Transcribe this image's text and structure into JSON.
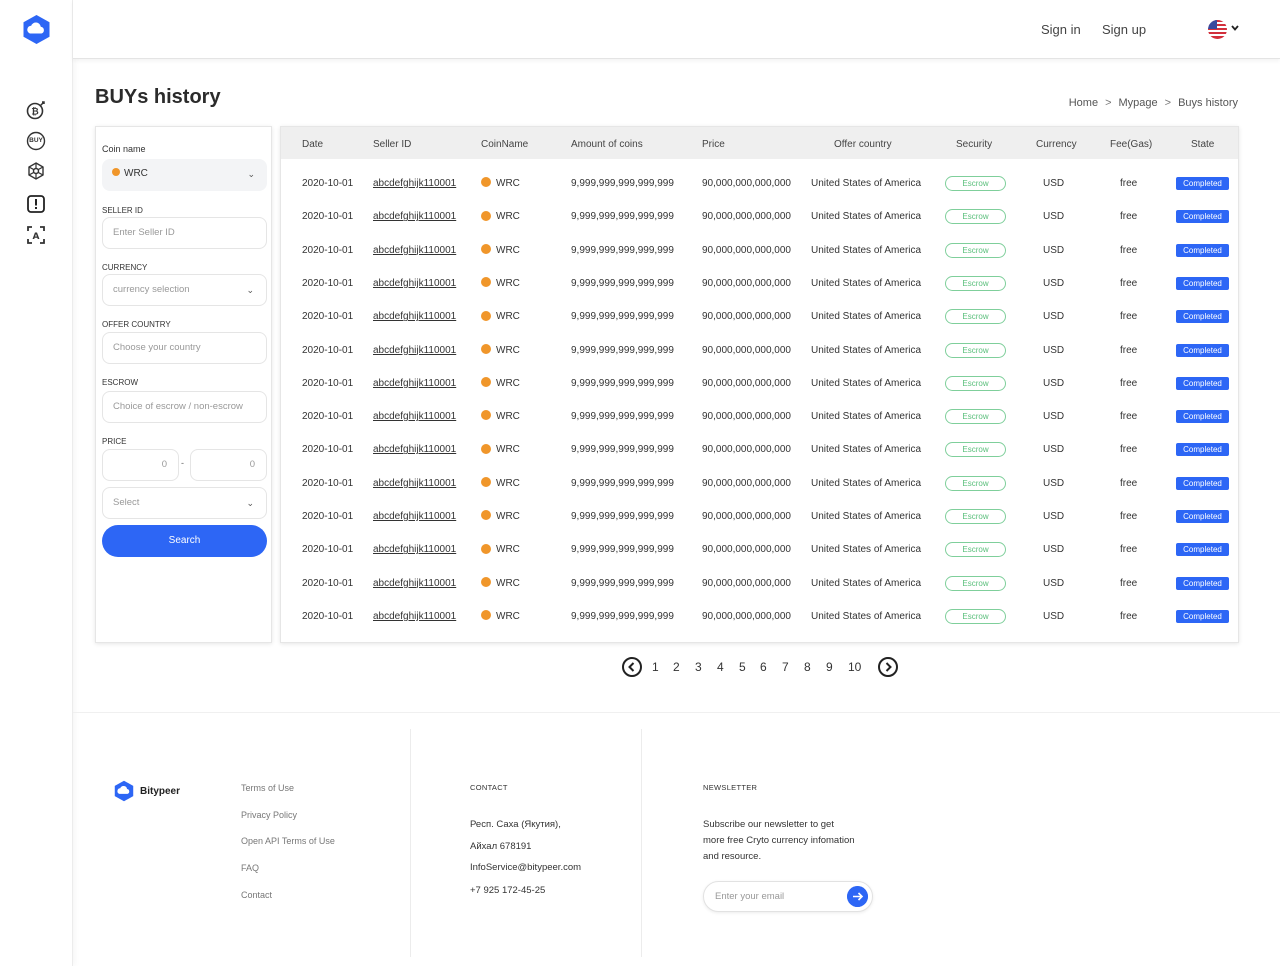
{
  "header": {
    "sign_in": "Sign in",
    "sign_up": "Sign up",
    "flag_icon": "us-flag-icon"
  },
  "sidebar": {
    "icons": [
      "bitcoin-target-icon",
      "buy-icon",
      "network-icon",
      "alert-icon",
      "scan-icon"
    ],
    "buy_text": "BUY"
  },
  "page": {
    "title": "BUYs history",
    "breadcrumb": [
      "Home",
      "Mypage",
      "Buys history"
    ],
    "sep": ">"
  },
  "filter": {
    "coin_label": "Coin name",
    "coin_value": "WRC",
    "seller_label": "SELLER ID",
    "seller_placeholder": "Enter Seller ID",
    "currency_label": "CURRENCY",
    "currency_placeholder": "currency selection",
    "country_label": "OFFER COUNTRY",
    "country_placeholder": "Choose your country",
    "escrow_label": "ESCROW",
    "escrow_placeholder": "Choice of escrow / non-escrow",
    "price_label": "PRICE",
    "price_min": "0",
    "price_dash": "-",
    "price_max": "0",
    "select_placeholder": "Select",
    "search_label": "Search"
  },
  "table": {
    "columns": [
      "Date",
      "Seller ID",
      "CoinName",
      "Amount of coins",
      "Price",
      "Offer country",
      "Security",
      "Currency",
      "Fee(Gas)",
      "State"
    ],
    "rows": [
      {
        "date": "2020-10-01",
        "seller": "abcdefghijk110001",
        "coin": "WRC",
        "amount": "9,999,999,999,999,999",
        "price": "90,000,000,000,000",
        "country": "United States of America",
        "security": "Escrow",
        "currency": "USD",
        "fee": "free",
        "state": "Completed"
      },
      {
        "date": "2020-10-01",
        "seller": "abcdefghijk110001",
        "coin": "WRC",
        "amount": "9,999,999,999,999,999",
        "price": "90,000,000,000,000",
        "country": "United States of America",
        "security": "Escrow",
        "currency": "USD",
        "fee": "free",
        "state": "Completed"
      },
      {
        "date": "2020-10-01",
        "seller": "abcdefghijk110001",
        "coin": "WRC",
        "amount": "9,999,999,999,999,999",
        "price": "90,000,000,000,000",
        "country": "United States of America",
        "security": "Escrow",
        "currency": "USD",
        "fee": "free",
        "state": "Completed"
      },
      {
        "date": "2020-10-01",
        "seller": "abcdefghijk110001",
        "coin": "WRC",
        "amount": "9,999,999,999,999,999",
        "price": "90,000,000,000,000",
        "country": "United States of America",
        "security": "Escrow",
        "currency": "USD",
        "fee": "free",
        "state": "Completed"
      },
      {
        "date": "2020-10-01",
        "seller": "abcdefghijk110001",
        "coin": "WRC",
        "amount": "9,999,999,999,999,999",
        "price": "90,000,000,000,000",
        "country": "United States of America",
        "security": "Escrow",
        "currency": "USD",
        "fee": "free",
        "state": "Completed"
      },
      {
        "date": "2020-10-01",
        "seller": "abcdefghijk110001",
        "coin": "WRC",
        "amount": "9,999,999,999,999,999",
        "price": "90,000,000,000,000",
        "country": "United States of America",
        "security": "Escrow",
        "currency": "USD",
        "fee": "free",
        "state": "Completed"
      },
      {
        "date": "2020-10-01",
        "seller": "abcdefghijk110001",
        "coin": "WRC",
        "amount": "9,999,999,999,999,999",
        "price": "90,000,000,000,000",
        "country": "United States of America",
        "security": "Escrow",
        "currency": "USD",
        "fee": "free",
        "state": "Completed"
      },
      {
        "date": "2020-10-01",
        "seller": "abcdefghijk110001",
        "coin": "WRC",
        "amount": "9,999,999,999,999,999",
        "price": "90,000,000,000,000",
        "country": "United States of America",
        "security": "Escrow",
        "currency": "USD",
        "fee": "free",
        "state": "Completed"
      },
      {
        "date": "2020-10-01",
        "seller": "abcdefghijk110001",
        "coin": "WRC",
        "amount": "9,999,999,999,999,999",
        "price": "90,000,000,000,000",
        "country": "United States of America",
        "security": "Escrow",
        "currency": "USD",
        "fee": "free",
        "state": "Completed"
      },
      {
        "date": "2020-10-01",
        "seller": "abcdefghijk110001",
        "coin": "WRC",
        "amount": "9,999,999,999,999,999",
        "price": "90,000,000,000,000",
        "country": "United States of America",
        "security": "Escrow",
        "currency": "USD",
        "fee": "free",
        "state": "Completed"
      },
      {
        "date": "2020-10-01",
        "seller": "abcdefghijk110001",
        "coin": "WRC",
        "amount": "9,999,999,999,999,999",
        "price": "90,000,000,000,000",
        "country": "United States of America",
        "security": "Escrow",
        "currency": "USD",
        "fee": "free",
        "state": "Completed"
      },
      {
        "date": "2020-10-01",
        "seller": "abcdefghijk110001",
        "coin": "WRC",
        "amount": "9,999,999,999,999,999",
        "price": "90,000,000,000,000",
        "country": "United States of America",
        "security": "Escrow",
        "currency": "USD",
        "fee": "free",
        "state": "Completed"
      },
      {
        "date": "2020-10-01",
        "seller": "abcdefghijk110001",
        "coin": "WRC",
        "amount": "9,999,999,999,999,999",
        "price": "90,000,000,000,000",
        "country": "United States of America",
        "security": "Escrow",
        "currency": "USD",
        "fee": "free",
        "state": "Completed"
      },
      {
        "date": "2020-10-01",
        "seller": "abcdefghijk110001",
        "coin": "WRC",
        "amount": "9,999,999,999,999,999",
        "price": "90,000,000,000,000",
        "country": "United States of America",
        "security": "Escrow",
        "currency": "USD",
        "fee": "free",
        "state": "Completed"
      }
    ]
  },
  "pagination": {
    "pages": [
      "1",
      "2",
      "3",
      "4",
      "5",
      "6",
      "7",
      "8",
      "9",
      "10"
    ]
  },
  "footer": {
    "brand": "Bitypeer",
    "links": [
      "Terms of Use",
      "Privacy Policy",
      "Open API Terms of Use",
      "FAQ",
      "Contact"
    ],
    "contact_heading": "CONTACT",
    "contact_lines": [
      "Респ. Саха (Якутия),",
      "Айхал 678191",
      "InfoService@bitypeer.com",
      "+7 925 172-45-25"
    ],
    "newsletter_heading": "NEWSLETTER",
    "newsletter_text": [
      "Subscribe our newsletter to get",
      "more free Cryto currency infomation",
      "and resource."
    ],
    "email_placeholder": "Enter your email"
  },
  "colors": {
    "accent": "#2d66f5",
    "escrow_green": "#5abf7b",
    "coin_orange": "#f0962a"
  }
}
